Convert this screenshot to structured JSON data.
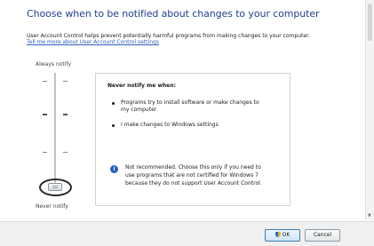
{
  "header": {
    "title": "Choose when to be notified about changes to your computer",
    "description": "User Account Control helps prevent potentially harmful programs from making changes to your computer.",
    "learn_more_link": "Tell me more about User Account Control settings"
  },
  "slider": {
    "top_label": "Always notify",
    "bottom_label": "Never notify",
    "levels": 4,
    "selected_level": 1
  },
  "panel": {
    "heading": "Never notify me when:",
    "bullets": [
      {
        "line1": "Programs try to install software or make changes to",
        "line2": "my computer"
      },
      {
        "line1": "I make changes to Windows settings",
        "line2": ""
      }
    ],
    "info_icon": "info-icon",
    "info_lines": [
      "Not recommended. Choose this only if you need to",
      "use programs that are not certified for Windows 7",
      "because they do not support User Account Control."
    ]
  },
  "footer": {
    "ok_label": "OK",
    "cancel_label": "Cancel",
    "ok_icon": "uac-shield-icon"
  },
  "colors": {
    "title": "#1e3f8f",
    "link": "#2b5fbf",
    "info": "#2b5fbf"
  }
}
